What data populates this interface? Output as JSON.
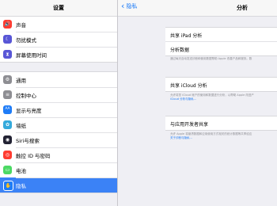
{
  "sidebar": {
    "title": "设置",
    "groups": [
      [
        {
          "label": "声音",
          "icon": "speaker-icon",
          "color": "#ff3b30",
          "glyph": "🔊"
        },
        {
          "label": "勿扰模式",
          "icon": "moon-icon",
          "color": "#5856d6",
          "glyph": "☾"
        },
        {
          "label": "屏幕使用时间",
          "icon": "hourglass-icon",
          "color": "#5856d6",
          "glyph": "⧗"
        }
      ],
      [
        {
          "label": "通用",
          "icon": "gear-icon",
          "color": "#8e8e93",
          "glyph": "⚙"
        },
        {
          "label": "控制中心",
          "icon": "control-center-icon",
          "color": "#8e8e93",
          "glyph": "≡"
        },
        {
          "label": "显示与亮度",
          "icon": "display-icon",
          "color": "#1e7cf7",
          "glyph": "AA"
        },
        {
          "label": "墙纸",
          "icon": "wallpaper-icon",
          "color": "#34aadc",
          "glyph": "✿"
        },
        {
          "label": "Siri与搜索",
          "icon": "siri-icon",
          "color": "#222233",
          "glyph": "◉"
        },
        {
          "label": "触控 ID 与密码",
          "icon": "fingerprint-icon",
          "color": "#ff3b30",
          "glyph": "◎"
        },
        {
          "label": "电池",
          "icon": "battery-icon",
          "color": "#4cd964",
          "glyph": "▭"
        },
        {
          "label": "隐私",
          "icon": "hand-icon",
          "color": "#1e7cf7",
          "glyph": "✋",
          "selected": true
        }
      ]
    ]
  },
  "detail": {
    "back_label": "隐私",
    "title": "分析",
    "sections": [
      {
        "rows": [
          "共享 iPad 分析",
          "分析数据"
        ],
        "footnote": "通过每天自动发送诊断和使用数据帮助 Apple 改善产品和服务。数",
        "footnote_link": ""
      },
      {
        "rows": [
          "共享 iCloud 分析"
        ],
        "footnote": "允许将您 iCloud 帐户的使用和数据进行分析，以帮助 Apple 改进产",
        "footnote_link": "iCloud 分析与隐私..."
      },
      {
        "rows": [
          "与应用开发者共享"
        ],
        "footnote": "允许 Apple 将崩溃数据和应用使用方式相关的统计数据等共享给应",
        "footnote_link": "关于诊断与隐私..."
      }
    ]
  }
}
